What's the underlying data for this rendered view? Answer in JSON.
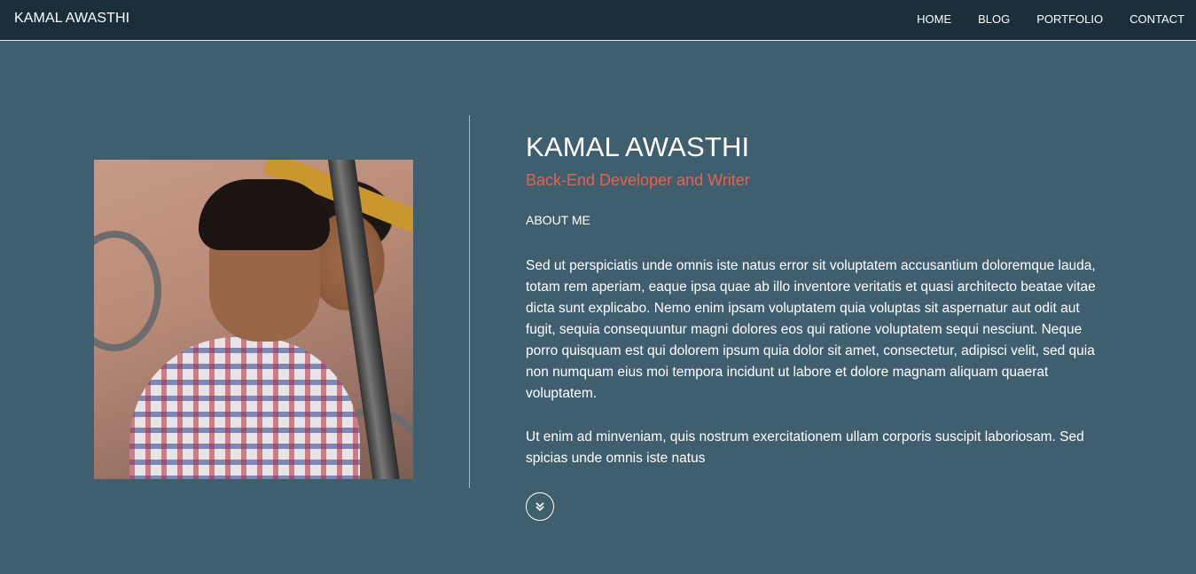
{
  "navbar": {
    "brand": "KAMAL AWASTHI",
    "links": [
      "HOME",
      "BLOG",
      "PORTFOLIO",
      "CONTACT"
    ]
  },
  "profile": {
    "name": "KAMAL AWASTHI",
    "subtitle": "Back-End Developer and Writer",
    "section_title": "ABOUT ME",
    "paragraphs": [
      "Sed ut perspiciatis unde omnis iste natus error sit voluptatem accusantium doloremque lauda, totam rem aperiam, eaque ipsa quae ab illo inventore veritatis et quasi architecto beatae vitae dicta sunt explicabo. Nemo enim ipsam voluptatem quia voluptas sit aspernatur aut odit aut fugit, sequia consequuntur magni dolores eos qui ratione voluptatem sequi nesciunt. Neque porro quisquam est qui dolorem ipsum quia dolor sit amet, consectetur, adipisci velit, sed quia non numquam eius moi tempora incidunt ut labore et dolore magnam aliquam quaerat voluptatem.",
      "Ut enim ad minveniam, quis nostrum exercitationem ullam corporis suscipit laboriosam. Sed spicias unde omnis iste natus"
    ],
    "scroll_icon": "double-chevron-down-icon"
  },
  "colors": {
    "background": "#3f5f6f",
    "navbar": "#1b2f3b",
    "accent": "#e8624a",
    "text": "#ffffff"
  }
}
